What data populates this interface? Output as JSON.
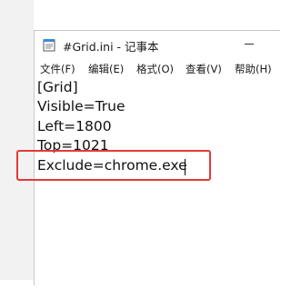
{
  "window": {
    "title": "#Grid.ini - 记事本"
  },
  "menu": {
    "items": [
      "文件(F)",
      "编辑(E)",
      "格式(O)",
      "查看(V)",
      "帮助(H)"
    ]
  },
  "editor": {
    "lines": [
      "[Grid]",
      "Visible=True",
      "Left=1800",
      "Top=1021",
      "Exclude=chrome.exe"
    ]
  },
  "colors": {
    "highlight_box": "#e53935"
  }
}
